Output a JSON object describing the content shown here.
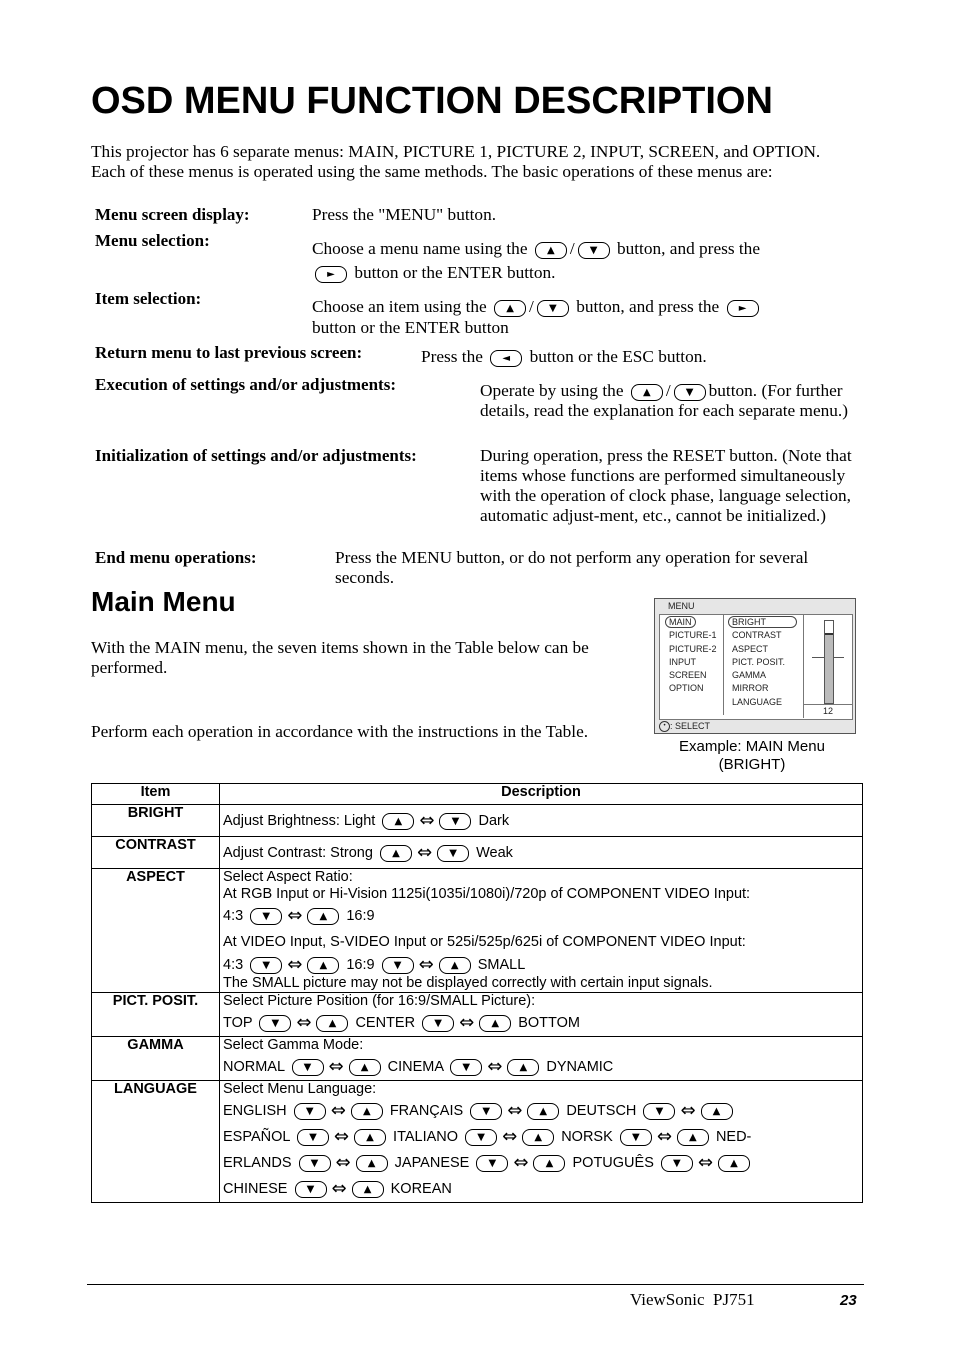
{
  "title": "OSD MENU FUNCTION DESCRIPTION",
  "intro": "This projector has 6 separate menus: MAIN, PICTURE 1, PICTURE 2, INPUT, SCREEN, and OPTION. Each of these menus is operated using the same methods. The basic operations of these menus are:",
  "operations": [
    {
      "label": "Menu screen display:",
      "parts": [
        "Press the \"MENU\" button."
      ]
    },
    {
      "label": "Menu selection:",
      "parts": [
        "Choose a menu name using the",
        "/",
        "button, and press the",
        "button or the ENTER button."
      ]
    },
    {
      "label": "Item selection:",
      "parts": [
        "Choose an item using the",
        "/",
        "button, and press the",
        "button or the ENTER button"
      ]
    },
    {
      "label": "Return menu to last previous screen:",
      "parts": [
        "Press the",
        "button or the ESC button."
      ]
    },
    {
      "label": "Execution of settings and/or adjustments:",
      "parts": [
        "Operate by using the",
        "/",
        "button. (For further details, read the explanation for each separate menu.)"
      ]
    },
    {
      "label": "Initialization of settings and/or adjustments:",
      "parts": [
        "During operation, press the RESET button. (Note that items whose functions are performed simultaneously with the operation of clock phase, language selection, automatic adjust-ment, etc., cannot be initialized.)"
      ]
    },
    {
      "label": "End menu operations:",
      "parts": [
        "Press the MENU button, or do not perform any operation for several seconds."
      ]
    }
  ],
  "main_menu": {
    "heading": "Main Menu",
    "para1": "With the MAIN menu, the seven items shown in the Table below can be performed.",
    "para2": "Perform each operation in accordance with the instructions in the Table."
  },
  "osd_example": {
    "header": "MENU",
    "menus": [
      "MAIN",
      "PICTURE-1",
      "PICTURE-2",
      "INPUT",
      "SCREEN",
      "OPTION"
    ],
    "items": [
      "BRIGHT",
      "CONTRAST",
      "ASPECT",
      "PICT. POSIT.",
      "GAMMA",
      "MIRROR",
      "LANGUAGE"
    ],
    "value": "12",
    "footer": ": SELECT",
    "caption_line1": "Example: MAIN Menu",
    "caption_line2": "(BRIGHT)"
  },
  "table": {
    "headers": [
      "Item",
      "Description"
    ],
    "rows": {
      "bright": {
        "item": "BRIGHT",
        "a": "Adjust Brightness: Light",
        "b": "Dark"
      },
      "contrast": {
        "item": "CONTRAST",
        "a": "Adjust Contrast: Strong",
        "b": "Weak"
      },
      "aspect": {
        "item": "ASPECT",
        "l1": "Select Aspect Ratio:",
        "l2": "At RGB Input or Hi-Vision 1125i(1035i/1080i)/720p of COMPONENT VIDEO Input:",
        "l3a": "4:3",
        "l3b": "16:9",
        "l4": "At VIDEO Input, S-VIDEO Input or 525i/525p/625i of COMPONENT VIDEO Input:",
        "l5a": "4:3",
        "l5b": "16:9",
        "l5c": "SMALL",
        "l6": "The SMALL picture may not be displayed correctly with certain input signals."
      },
      "pict": {
        "item": "PICT. POSIT.",
        "l1": "Select Picture Position (for 16:9/SMALL Picture):",
        "o": [
          "TOP",
          "CENTER",
          "BOTTOM"
        ]
      },
      "gamma": {
        "item": "GAMMA",
        "l1": "Select Gamma Mode:",
        "o": [
          "NORMAL",
          "CINEMA",
          "DYNAMIC"
        ]
      },
      "language": {
        "item": "LANGUAGE",
        "l1": "Select Menu Language:",
        "o": [
          "ENGLISH",
          "FRANÇAIS",
          "DEUTSCH",
          "ESPAÑOL",
          "ITALIANO",
          "NORSK",
          "NED-",
          "ERLANDS",
          "JAPANESE",
          "POTUGUÊS",
          "CHINESE",
          "KOREAN"
        ]
      }
    }
  },
  "footer": {
    "brand": "ViewSonic  PJ751",
    "page": "23"
  }
}
